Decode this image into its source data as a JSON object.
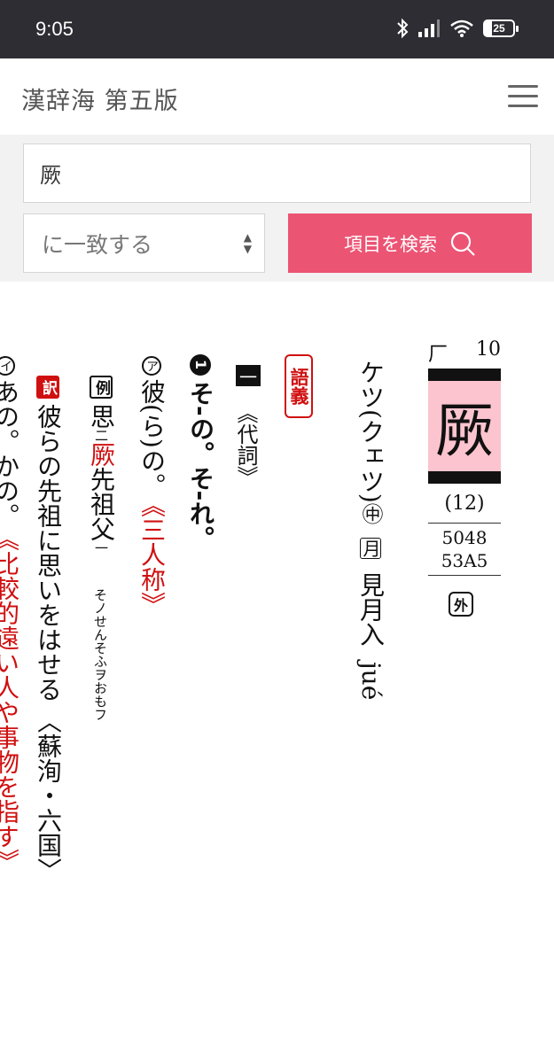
{
  "status": {
    "time": "9:05",
    "battery": "25",
    "battery_level": 0.25
  },
  "header": {
    "title": "漢辞海 第五版"
  },
  "search": {
    "query": "厥",
    "match_mode": "に一致する",
    "button_label": "項目を検索"
  },
  "entry": {
    "radical": "厂",
    "radical_strokes": "10",
    "kanji": "厥",
    "stroke_count": "(12)",
    "code_jis": "5048",
    "code_unicode": "53A5",
    "gai_label": "外",
    "reading_kana": "ケツ(クェツ)",
    "kan_mark": "㊥",
    "rhyme_box": "月",
    "rhyme_text": "見月入",
    "pinyin": "jué",
    "gogi_label": "語義",
    "section_label": "一",
    "pos": "《代詞》",
    "sense_num": "1",
    "sense_text": "そ-の。そ-れ。",
    "sub_mark": "ア",
    "sub_text_1": "彼(ら)の。",
    "sub_text_2": "《三人称》",
    "example_label": "例",
    "example_pre": "思",
    "example_kaeri": "二",
    "example_red": "厥",
    "example_post": "先祖父",
    "example_kaeri2": "一",
    "example_furigana": "そノせんそふヲおもフ",
    "translation_label": "訳",
    "translation_text": "彼らの先祖に思いをはせる",
    "source": "〈蘇洵・六国〉",
    "sub_mark_2": "イ",
    "sub2_text": "あの。かの。",
    "sub2_note": "《比較的遠い人や事物を指す》"
  }
}
